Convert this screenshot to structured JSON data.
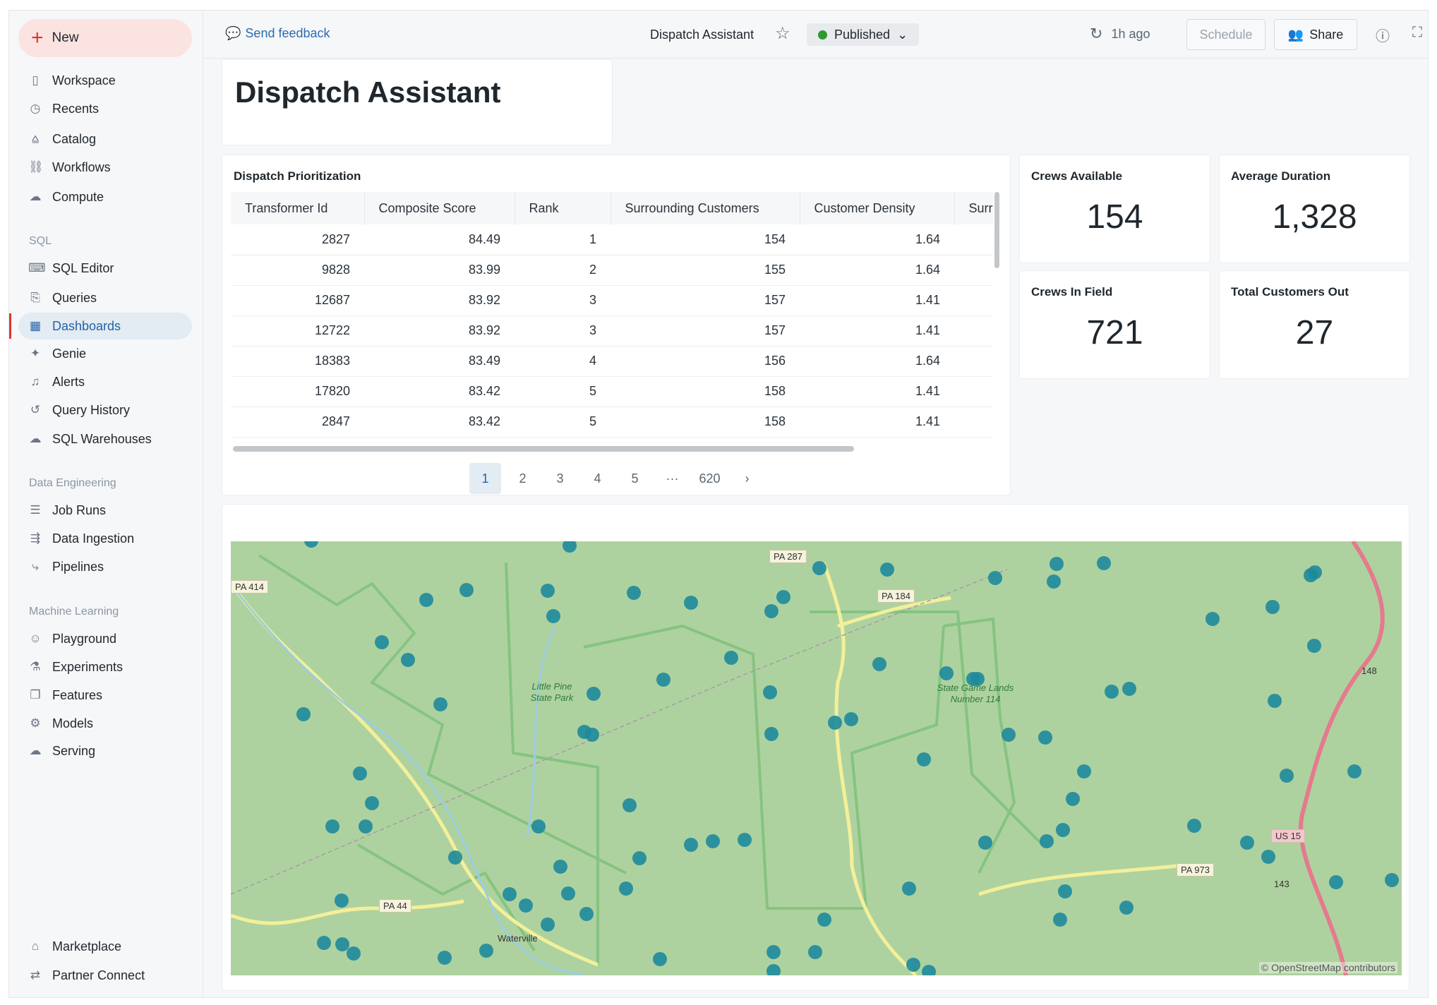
{
  "sidebar": {
    "new_label": "New",
    "items": [
      {
        "label": "Workspace",
        "icon": "workspace-icon",
        "glyph": "▯"
      },
      {
        "label": "Recents",
        "icon": "clock-icon",
        "glyph": "◷"
      },
      {
        "label": "Catalog",
        "icon": "catalog-icon",
        "glyph": "⩠"
      },
      {
        "label": "Workflows",
        "icon": "workflows-icon",
        "glyph": "⛓"
      },
      {
        "label": "Compute",
        "icon": "cloud-icon",
        "glyph": "☁"
      }
    ],
    "sql_header": "SQL",
    "sql_items": [
      {
        "label": "SQL Editor",
        "icon": "sql-editor-icon",
        "glyph": "⌨"
      },
      {
        "label": "Queries",
        "icon": "queries-icon",
        "glyph": "⎘"
      },
      {
        "label": "Dashboards",
        "icon": "dashboard-icon",
        "glyph": "▦"
      },
      {
        "label": "Genie",
        "icon": "genie-icon",
        "glyph": "✦"
      },
      {
        "label": "Alerts",
        "icon": "bell-icon",
        "glyph": "♫"
      },
      {
        "label": "Query History",
        "icon": "history-icon",
        "glyph": "↺"
      },
      {
        "label": "SQL Warehouses",
        "icon": "warehouse-icon",
        "glyph": "☁"
      }
    ],
    "de_header": "Data Engineering",
    "de_items": [
      {
        "label": "Job Runs",
        "icon": "job-runs-icon",
        "glyph": "☰"
      },
      {
        "label": "Data Ingestion",
        "icon": "ingestion-icon",
        "glyph": "⇶"
      },
      {
        "label": "Pipelines",
        "icon": "pipelines-icon",
        "glyph": "⤷"
      }
    ],
    "ml_header": "Machine Learning",
    "ml_items": [
      {
        "label": "Playground",
        "icon": "robot-icon",
        "glyph": "☺"
      },
      {
        "label": "Experiments",
        "icon": "flask-icon",
        "glyph": "⚗"
      },
      {
        "label": "Features",
        "icon": "features-icon",
        "glyph": "❐"
      },
      {
        "label": "Models",
        "icon": "models-icon",
        "glyph": "⚙"
      },
      {
        "label": "Serving",
        "icon": "serving-icon",
        "glyph": "☁"
      }
    ],
    "bottom_items": [
      {
        "label": "Marketplace",
        "icon": "marketplace-icon",
        "glyph": "⌂"
      },
      {
        "label": "Partner Connect",
        "icon": "partner-connect-icon",
        "glyph": "⇄"
      }
    ]
  },
  "header": {
    "feedback": "Send feedback",
    "title": "Dispatch Assistant",
    "status": "Published",
    "status_color": "#2e9a2e",
    "refreshed": "1h ago",
    "schedule": "Schedule",
    "share": "Share"
  },
  "dashboard": {
    "title": "Dispatch Assistant",
    "table": {
      "title": "Dispatch Prioritization",
      "columns": [
        "Transformer Id",
        "Composite Score",
        "Rank",
        "Surrounding Customers",
        "Customer Density",
        "Surr"
      ],
      "rows": [
        [
          "2827",
          "84.49",
          "1",
          "154",
          "1.64"
        ],
        [
          "9828",
          "83.99",
          "2",
          "155",
          "1.64"
        ],
        [
          "12687",
          "83.92",
          "3",
          "157",
          "1.41"
        ],
        [
          "12722",
          "83.92",
          "3",
          "157",
          "1.41"
        ],
        [
          "18383",
          "83.49",
          "4",
          "156",
          "1.64"
        ],
        [
          "17820",
          "83.42",
          "5",
          "158",
          "1.41"
        ],
        [
          "2847",
          "83.42",
          "5",
          "158",
          "1.41"
        ]
      ],
      "pages": [
        "1",
        "2",
        "3",
        "4",
        "5"
      ],
      "ellipsis": "···",
      "last_page": "620",
      "next": "›",
      "current_page": 1
    },
    "kpis": [
      {
        "label": "Crews Available",
        "value": "154"
      },
      {
        "label": "Average Duration",
        "value": "1,328"
      },
      {
        "label": "Crews In Field",
        "value": "721"
      },
      {
        "label": "Total Customers Out",
        "value": "27"
      }
    ],
    "map": {
      "road_labels": [
        "PA 414",
        "PA 287",
        "PA 184",
        "PA 44",
        "PA 973",
        "US 15",
        "148",
        "143"
      ],
      "places": [
        "Little Pine State Park",
        "State Game Lands Number 114",
        "Waterville"
      ],
      "attribution": "© OpenStreetMap contributors",
      "marker_color": "#1e8a9c"
    }
  }
}
